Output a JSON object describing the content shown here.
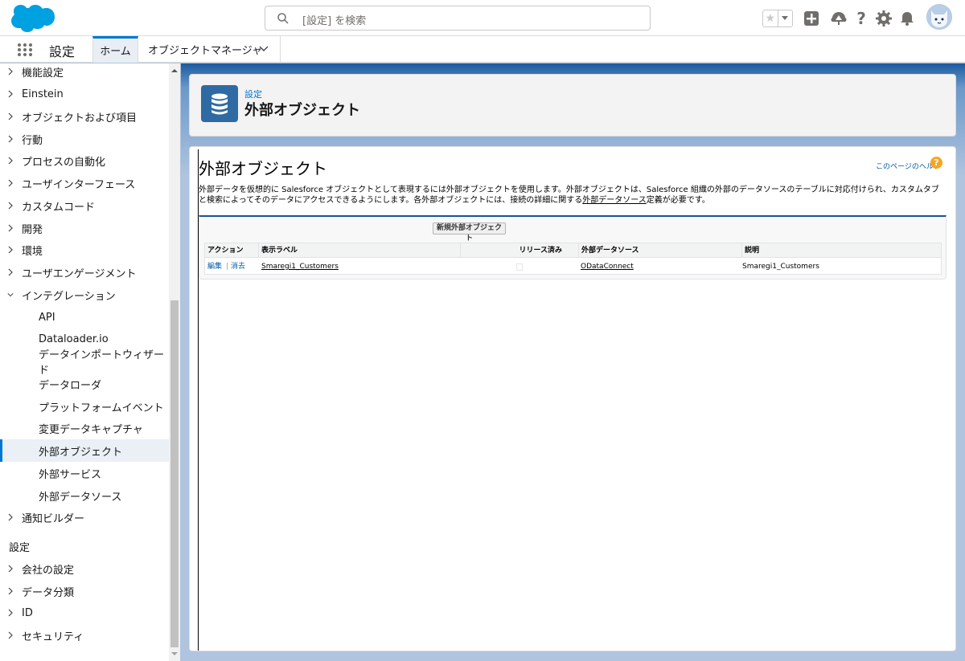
{
  "header": {
    "search_placeholder": "[設定] を検索"
  },
  "app_nav": {
    "app_name": "設定",
    "tabs": [
      {
        "label": "ホーム"
      },
      {
        "label": "オブジェクトマネージャ"
      }
    ]
  },
  "sidebar": {
    "items": [
      {
        "label": "機能設定"
      },
      {
        "label": "Einstein"
      },
      {
        "label": "オブジェクトおよび項目"
      },
      {
        "label": "行動"
      },
      {
        "label": "プロセスの自動化"
      },
      {
        "label": "ユーザインターフェース"
      },
      {
        "label": "カスタムコード"
      },
      {
        "label": "開発"
      },
      {
        "label": "環境"
      },
      {
        "label": "ユーザエンゲージメント"
      },
      {
        "label": "インテグレーション"
      }
    ],
    "sub_items": [
      {
        "label": "API"
      },
      {
        "label": "Dataloader.io"
      },
      {
        "label": "データインポートウィザード"
      },
      {
        "label": "データローダ"
      },
      {
        "label": "プラットフォームイベント"
      },
      {
        "label": "変更データキャプチャ"
      },
      {
        "label": "外部オブジェクト"
      },
      {
        "label": "外部サービス"
      },
      {
        "label": "外部データソース"
      }
    ],
    "after_items": [
      {
        "label": "通知ビルダー"
      }
    ],
    "section_title": "設定",
    "section_items": [
      {
        "label": "会社の設定"
      },
      {
        "label": "データ分類"
      },
      {
        "label": "ID"
      },
      {
        "label": "セキュリティ"
      }
    ]
  },
  "page_header": {
    "breadcrumb": "設定",
    "title": "外部オブジェクト"
  },
  "content": {
    "title": "外部オブジェクト",
    "help_link": "このページのヘルプ",
    "description_1": "外部データを仮想的に Salesforce オブジェクトとして表現するには外部オブジェクトを使用します。外部オブジェクトは、Salesforce 組織の外部のデータソースのテーブルに対応付けられ、カスタムタブと検索によってそのデータにアクセスできるようにします。各外部オブジェクトには、接続の詳細に関する",
    "description_link": "外部データソース",
    "description_2": "定義が必要です。",
    "new_button": "新規外部オブジェクト",
    "table": {
      "headers": [
        "アクション",
        "表示ラベル",
        "リリース済み",
        "外部データソース",
        "説明"
      ],
      "rows": [
        {
          "action_edit": "編集",
          "action_sep": "|",
          "action_delete": "消去",
          "label": "Smaregi1_Customers",
          "deployed": false,
          "data_source": "ODataConnect",
          "description": "Smaregi1_Customers"
        }
      ]
    }
  },
  "colors": {
    "brand_blue": "#0176d3",
    "link_blue": "#015ba7",
    "header_icon_bg": "#2f6aa3"
  }
}
